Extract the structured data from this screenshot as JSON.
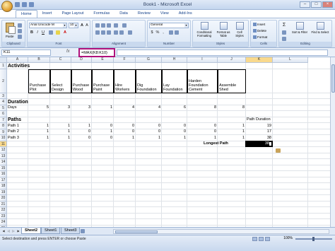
{
  "window": {
    "title": "Book1 - Microsoft Excel"
  },
  "tabs": [
    "Home",
    "Insert",
    "Page Layout",
    "Formulas",
    "Data",
    "Review",
    "View",
    "Add-Ins"
  ],
  "ribbon": {
    "paste_label": "Paste",
    "font_name": "Arial Unicode M",
    "font_size": "10",
    "number_format": "General",
    "conditional_formatting": "Conditional Formatting",
    "format_as_table": "Format as Table",
    "cell_styles": "Cell Styles",
    "insert": "Insert",
    "delete": "Delete",
    "format": "Format",
    "sort_filter": "Sort & Filter",
    "find_select": "Find & Select",
    "group_clipboard": "Clipboard",
    "group_font": "Font",
    "group_alignment": "Alignment",
    "group_number": "Number",
    "group_styles": "Styles",
    "group_cells": "Cells",
    "group_editing": "Editing",
    "number_symbols": [
      "$",
      "%",
      ","
    ]
  },
  "formula_bar": {
    "name_box": "K11",
    "fx": "fx",
    "formula": "=MAX(K8:K10)"
  },
  "columns": [
    "A",
    "B",
    "C",
    "D",
    "E",
    "F",
    "G",
    "H",
    "I",
    "J",
    "K",
    "L"
  ],
  "rows": [
    "1",
    "2",
    "3",
    "4",
    "5",
    "6",
    "7",
    "8",
    "9",
    "10",
    "11",
    "12",
    "13",
    "14",
    "15",
    "16",
    "17",
    "18",
    "19",
    "20",
    "21",
    "22",
    "23",
    "24",
    "25",
    "26",
    "27"
  ],
  "sheet": {
    "activities_title": "Activities",
    "activity_headers": [
      "Purchase Plot",
      "Select Design",
      "Purchase Wood",
      "Purchase Paint",
      "Hire Workers",
      "Dig Foundation",
      "Lay Foundation",
      "Harden Foundation Cement",
      "Assemble Shed"
    ],
    "duration_title": "Duration",
    "days_label": "Days",
    "days_values": [
      "5",
      "3",
      "3",
      "1",
      "4",
      "4",
      "6",
      "8",
      "8"
    ],
    "paths_title": "Paths",
    "path_duration_label": "Path Duration",
    "paths": [
      {
        "label": "Path 1",
        "values": [
          "1",
          "1",
          "1",
          "0",
          "0",
          "0",
          "0",
          "0",
          "1"
        ],
        "duration": "19"
      },
      {
        "label": "Path 2",
        "values": [
          "1",
          "1",
          "0",
          "1",
          "0",
          "0",
          "0",
          "0",
          "1"
        ],
        "duration": "17"
      },
      {
        "label": "Path 3",
        "values": [
          "1",
          "1",
          "0",
          "0",
          "1",
          "1",
          "1",
          "1",
          "1"
        ],
        "duration": "38"
      }
    ],
    "longest_path_label": "Longest Path",
    "longest_path_value": "38"
  },
  "sheet_tabs": [
    "Sheet2",
    "Sheet1",
    "Sheet3"
  ],
  "status": {
    "text": "Select destination and press ENTER or choose Paste",
    "zoom": "100%"
  }
}
